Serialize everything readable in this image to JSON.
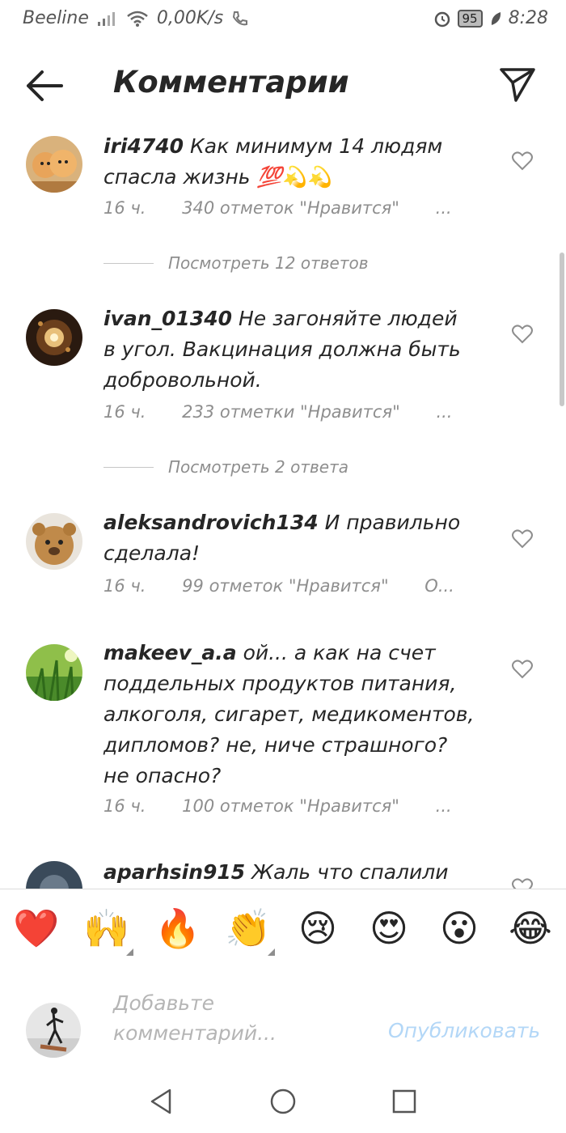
{
  "status_bar": {
    "carrier": "Beeline",
    "speed": "0,00K/s",
    "battery": "95",
    "time": "8:28"
  },
  "header": {
    "title": "Комментарии"
  },
  "comments": [
    {
      "username": "iri4740",
      "text": "Как минимум 14 людям спасла жизнь 💯💫💫",
      "time": "16 ч.",
      "likes": "340 отметок \"Нравится\"",
      "more": "...",
      "replies": "Посмотреть 12 ответов"
    },
    {
      "username": "ivan_01340",
      "text": "Не загоняйте людей в угол. Вакцинация должна быть добровольной.",
      "time": "16 ч.",
      "likes": "233 отметки \"Нравится\"",
      "more": "...",
      "replies": "Посмотреть 2 ответа"
    },
    {
      "username": "aleksandrovich134",
      "text": "И правильно сделала!",
      "time": "16 ч.",
      "likes": "99 отметок \"Нравится\"",
      "more": "О..."
    },
    {
      "username": "makeev_a.a",
      "text": "ой... а как на счет поддельных продуктов питания, алкоголя, сигарет, медикоментов, дипломов? не, ниче страшного? не опасно?",
      "time": "16 ч.",
      "likes": "100 отметок \"Нравится\"",
      "more": "..."
    },
    {
      "username": "aparhsin915",
      "text": "Жаль что спалили 😢"
    }
  ],
  "emoji_bar": [
    "❤️",
    "🙌",
    "🔥",
    "👏",
    "😢",
    "😍",
    "😮",
    "😂"
  ],
  "input": {
    "placeholder": "Добавьте комментарий...",
    "publish_label": "Опубликовать"
  },
  "colors": {
    "text": "#262626",
    "secondary": "#8e8e8e",
    "publish_disabled": "#b3d7f7",
    "heart_emoji": "#e0242d"
  },
  "icons": [
    "back-arrow-icon",
    "send-icon",
    "heart-outline-icon",
    "nav-back-icon",
    "nav-home-icon",
    "nav-recent-icon"
  ]
}
